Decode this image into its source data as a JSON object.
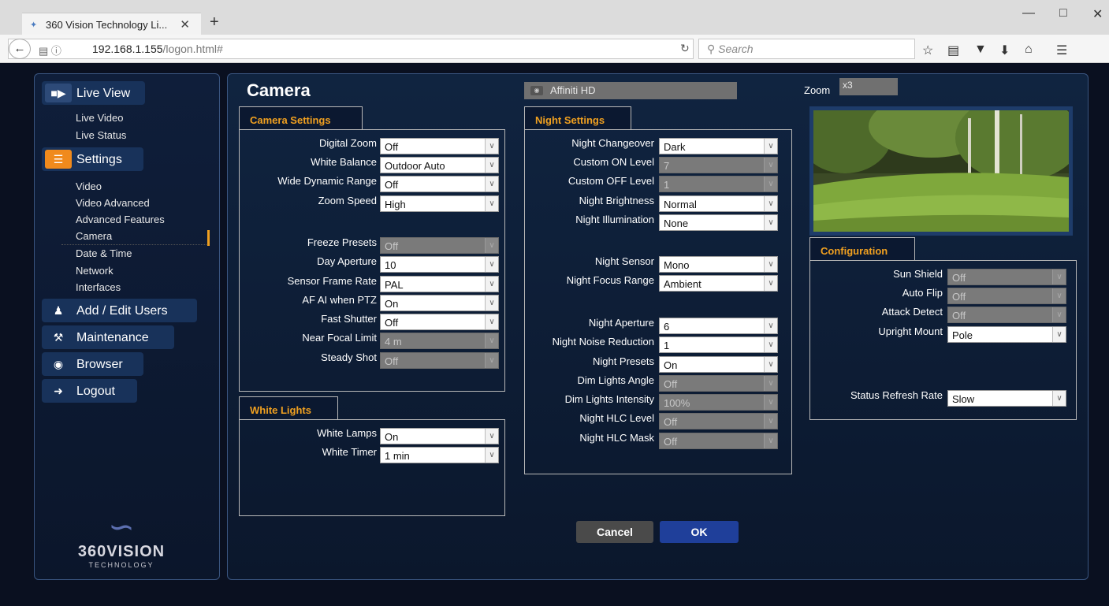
{
  "browser": {
    "tab_title": "360 Vision Technology Li...",
    "url_host": "192.168.1.155",
    "url_path": "/logon.html#",
    "search_placeholder": "Search"
  },
  "sidebar": {
    "live_view": "Live View",
    "live_items": [
      "Live Video",
      "Live Status"
    ],
    "settings": "Settings",
    "settings_items": [
      "Video",
      "Video Advanced",
      "Advanced Features",
      "Camera",
      "Date & Time",
      "Network",
      "Interfaces"
    ],
    "active_item": "Camera",
    "add_users": "Add / Edit Users",
    "maintenance": "Maintenance",
    "browser": "Browser",
    "logout": "Logout",
    "logo_brand": "360VISION",
    "logo_tagline": "TECHNOLOGY"
  },
  "page": {
    "title": "Camera",
    "camera_name": "Affiniti HD",
    "zoom_label": "Zoom",
    "zoom_value": "x3"
  },
  "camera_settings": {
    "tab": "Camera Settings",
    "rows": [
      {
        "label": "Digital Zoom",
        "value": "Off",
        "disabled": false
      },
      {
        "label": "White Balance",
        "value": "Outdoor Auto",
        "disabled": false
      },
      {
        "label": "Wide Dynamic Range",
        "value": "Off",
        "disabled": false
      },
      {
        "label": "Zoom Speed",
        "value": "High",
        "disabled": false
      },
      {
        "label": "Freeze Presets",
        "value": "Off",
        "disabled": true
      },
      {
        "label": "Day Aperture",
        "value": "10",
        "disabled": false
      },
      {
        "label": "Sensor Frame Rate",
        "value": "PAL",
        "disabled": false
      },
      {
        "label": "AF AI when PTZ",
        "value": "On",
        "disabled": false
      },
      {
        "label": "Fast Shutter",
        "value": "Off",
        "disabled": false
      },
      {
        "label": "Near Focal Limit",
        "value": "4 m",
        "disabled": true
      },
      {
        "label": "Steady Shot",
        "value": "Off",
        "disabled": true
      }
    ]
  },
  "white_lights": {
    "tab": "White Lights",
    "rows": [
      {
        "label": "White Lamps",
        "value": "On",
        "disabled": false
      },
      {
        "label": "White Timer",
        "value": "1 min",
        "disabled": false
      }
    ]
  },
  "night_settings": {
    "tab": "Night Settings",
    "rows": [
      {
        "label": "Night Changeover",
        "value": "Dark",
        "disabled": false
      },
      {
        "label": "Custom ON Level",
        "value": "7",
        "disabled": true
      },
      {
        "label": "Custom OFF Level",
        "value": "1",
        "disabled": true
      },
      {
        "label": "Night Brightness",
        "value": "Normal",
        "disabled": false
      },
      {
        "label": "Night Illumination",
        "value": "None",
        "disabled": false
      },
      {
        "label": "Night Sensor",
        "value": "Mono",
        "disabled": false
      },
      {
        "label": "Night Focus Range",
        "value": "Ambient",
        "disabled": false
      },
      {
        "label": "Night Aperture",
        "value": "6",
        "disabled": false
      },
      {
        "label": "Night Noise Reduction",
        "value": "1",
        "disabled": false
      },
      {
        "label": "Night Presets",
        "value": "On",
        "disabled": false
      },
      {
        "label": "Dim Lights Angle",
        "value": "Off",
        "disabled": true
      },
      {
        "label": "Dim Lights Intensity",
        "value": "100%",
        "disabled": true
      },
      {
        "label": "Night HLC Level",
        "value": "Off",
        "disabled": true
      },
      {
        "label": "Night HLC Mask",
        "value": "Off",
        "disabled": true
      }
    ]
  },
  "configuration": {
    "tab": "Configuration",
    "rows": [
      {
        "label": "Sun Shield",
        "value": "Off",
        "disabled": true
      },
      {
        "label": "Auto Flip",
        "value": "Off",
        "disabled": true
      },
      {
        "label": "Attack Detect",
        "value": "Off",
        "disabled": true
      },
      {
        "label": "Upright Mount",
        "value": "Pole",
        "disabled": false
      },
      {
        "label": "Status Refresh Rate",
        "value": "Slow",
        "disabled": false
      }
    ]
  },
  "buttons": {
    "cancel": "Cancel",
    "ok": "OK"
  }
}
